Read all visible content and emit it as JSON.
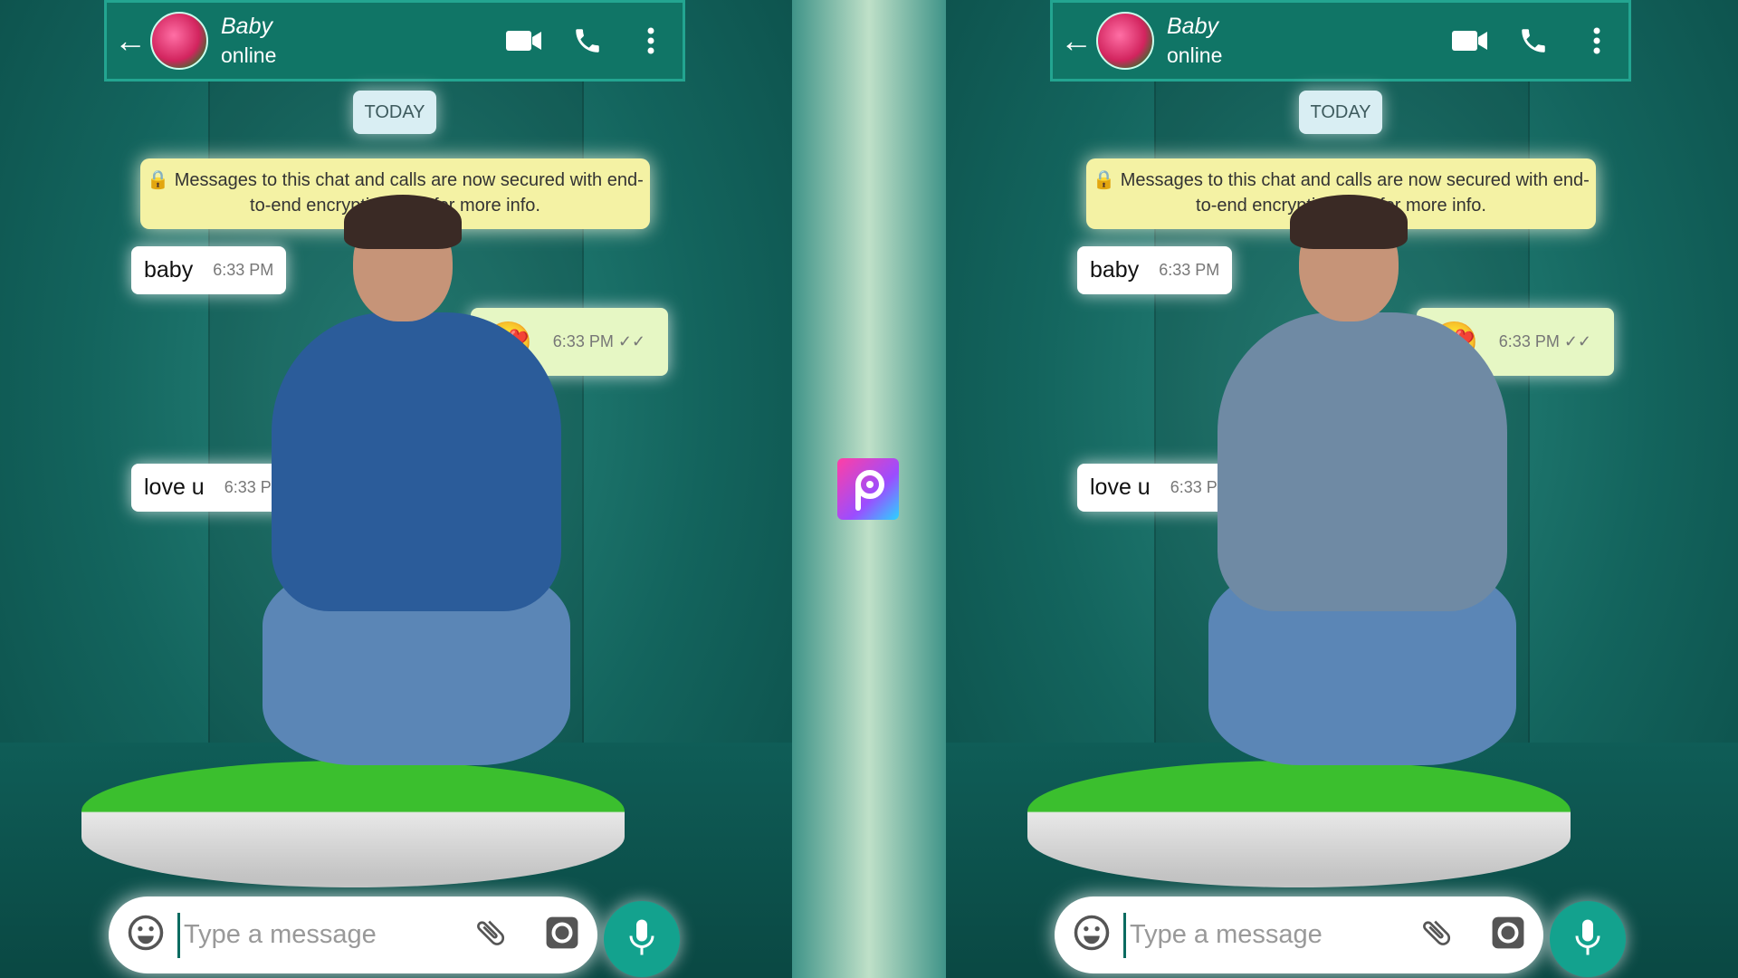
{
  "accent": "#107566",
  "panels": [
    {
      "header": {
        "name": "Baby",
        "status": "online"
      },
      "date_label": "TODAY",
      "encryption_notice": "Messages to this chat and calls are now secured with end-to-end encryption. Tap for more info.",
      "messages": [
        {
          "text": "baby",
          "time": "6:33 PM",
          "direction": "in"
        },
        {
          "text": "😍",
          "time": "6:33 PM ✓✓",
          "direction": "out"
        },
        {
          "text": "love u",
          "time": "6:33 PM",
          "direction": "in"
        }
      ],
      "input": {
        "placeholder": "Type a message"
      },
      "shirt_color": "#2b5c9a",
      "icons": [
        "back-arrow-icon",
        "video-call-icon",
        "phone-icon",
        "more-vert-icon",
        "emoji-icon",
        "attach-icon",
        "camera-icon",
        "mic-icon"
      ]
    },
    {
      "header": {
        "name": "Baby",
        "status": "online"
      },
      "date_label": "TODAY",
      "encryption_notice": "Messages to this chat and calls are now secured with end-to-end encryption. Tap for more info.",
      "messages": [
        {
          "text": "baby",
          "time": "6:33 PM",
          "direction": "in"
        },
        {
          "text": "😍",
          "time": "6:33 PM ✓✓",
          "direction": "out"
        },
        {
          "text": "love u",
          "time": "6:33 PM",
          "direction": "in"
        }
      ],
      "input": {
        "placeholder": "Type a message"
      },
      "shirt_color": "#6f8aa4"
    }
  ],
  "center_logo": "picsart-logo"
}
